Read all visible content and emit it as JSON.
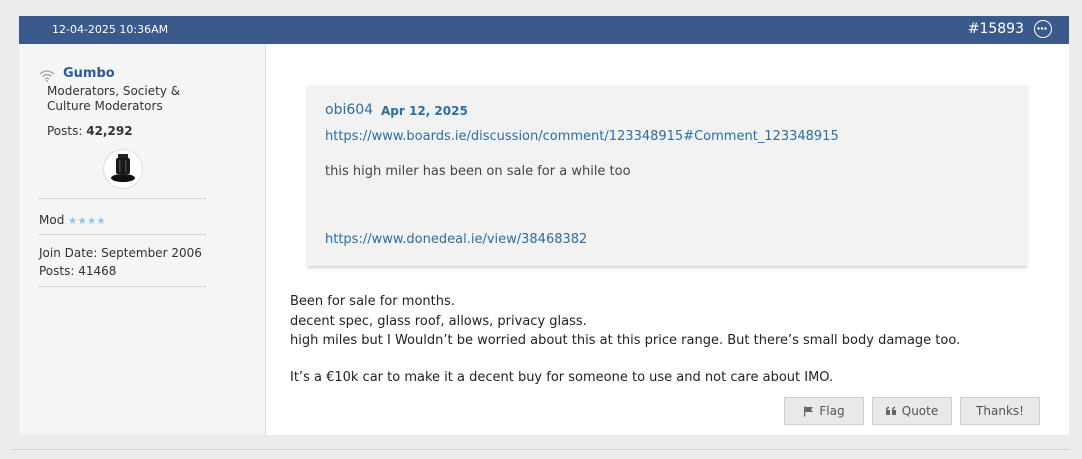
{
  "post": {
    "date": "12-04-2025 10:36AM",
    "number": "#15893",
    "menu_icon": "ellipsis-circle-icon"
  },
  "user": {
    "name": "Gumbo",
    "title": "Moderators, Society & Culture Moderators",
    "posts_label": "Posts:",
    "posts_count": "42,292",
    "rank": "Mod",
    "rank_stars": "★★★★",
    "join_date": "Join Date: September 2006",
    "posts_line": "Posts: 41468"
  },
  "quote": {
    "author": "obi604",
    "date": "Apr 12, 2025",
    "link": "https://www.boards.ie/discussion/comment/123348915#Comment_123348915",
    "text": "this high miler has been on sale for a while too",
    "link2": "https://www.donedeal.ie/view/38468382"
  },
  "body": {
    "line1": "Been for sale for months.",
    "line2": "decent spec, glass roof, allows, privacy glass.",
    "line3": "high miles but I Wouldn’t be worried about this at this price range. But there’s small body damage too.",
    "line4": "It’s a €10k car to make it a decent buy for someone to use and not care about IMO."
  },
  "actions": {
    "flag": "Flag",
    "quote": "Quote",
    "thanks": "Thanks!"
  },
  "colors": {
    "header": "#3b5a8c",
    "link": "#2a6ea8",
    "username": "#2a5aa0"
  }
}
